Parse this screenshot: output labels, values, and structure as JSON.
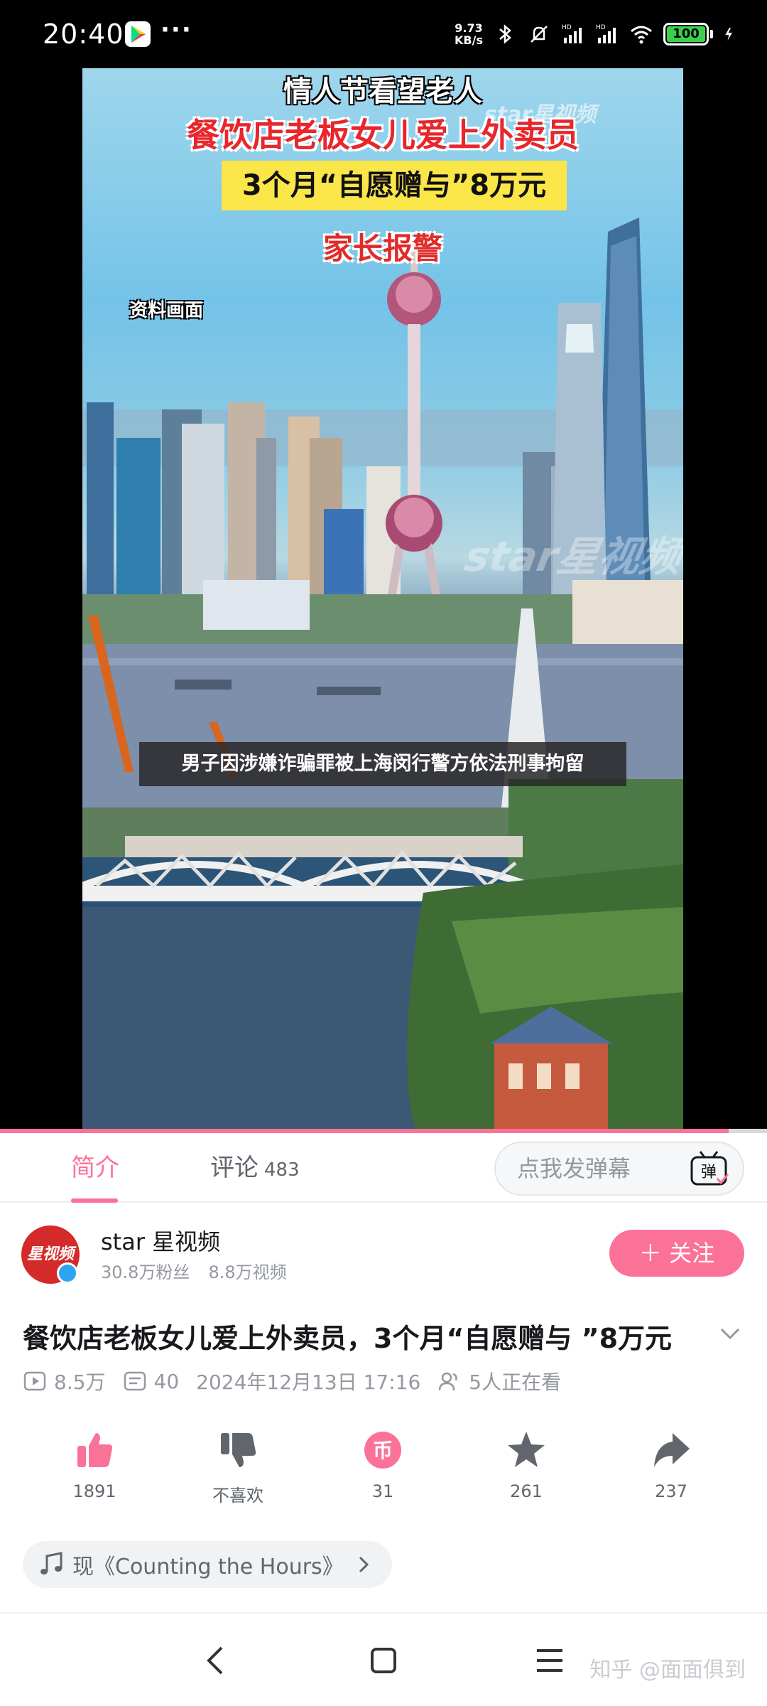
{
  "status_bar": {
    "time": "20:40",
    "menu_dots": "···",
    "net_speed_value": "9.73",
    "net_speed_unit": "KB/s",
    "battery": "100",
    "icons": [
      "play-store-icon",
      "bluetooth-icon",
      "mute-icon",
      "signal-hd-icon",
      "signal-hd-icon",
      "wifi-icon",
      "battery-icon",
      "charging-icon"
    ]
  },
  "video": {
    "caption_line1": "情人节看望老人",
    "caption_line2": "餐饮店老板女儿爱上外卖员",
    "caption_line3": "3个月“自愿赠与”8万元",
    "caption_line4": "家长报警",
    "caption_source": "资料画面",
    "watermark_top": "star星视频",
    "watermark_mid": "star星视频",
    "subtitle": "男子因涉嫌诈骗罪被上海闵行警方依法刑事拘留",
    "progress": 0.95,
    "accent_color": "#fb7299"
  },
  "tabs": {
    "intro": "简介",
    "comments": "评论",
    "comment_count": "483",
    "danmaku_placeholder": "点我发弹幕",
    "danmaku_icon_char": "弹"
  },
  "uploader": {
    "name": "star 星视频",
    "avatar_text": "星视频",
    "followers": "30.8万粉丝",
    "videos": "8.8万视频",
    "follow_label": "＋ 关注"
  },
  "video_info": {
    "title": "餐饮店老板女儿爱上外卖员，3个月“自愿赠与 ”8万元",
    "views": "8.5万",
    "danmaku_count": "40",
    "date": "2024年12月13日 17:16",
    "watching": "5人正在看"
  },
  "actions": {
    "like": "1891",
    "dislike": "不喜欢",
    "coin": "31",
    "favorite": "261",
    "share": "237"
  },
  "music": {
    "label": "现《Counting the Hours》"
  },
  "navbar": {
    "watermark": "知乎 @面面俱到"
  }
}
